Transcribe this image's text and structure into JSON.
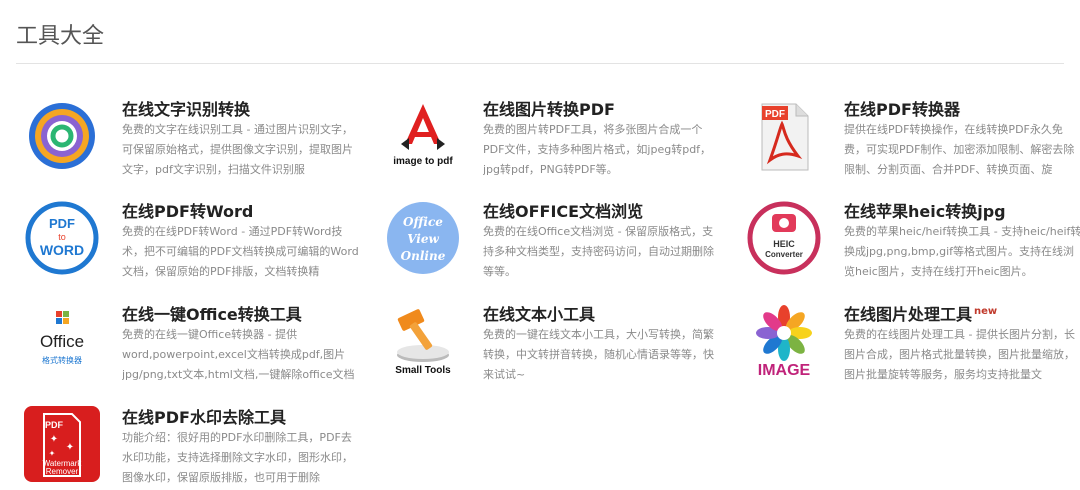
{
  "page": {
    "title": "工具大全"
  },
  "tools": [
    {
      "title": "在线文字识别转换",
      "desc": "免费的文字在线识别工具 - 通过图片识别文字，可保留原始格式，提供图像文字识别，提取图片文字，pdf文字识别，扫描文件识别服",
      "icon": "ocr-ring-icon"
    },
    {
      "title": "在线图片转换PDF",
      "desc": "免费的图片转PDF工具，将多张图片合成一个PDF文件，支持多种图片格式，如jpeg转pdf，jpg转pdf，PNG转PDF等。",
      "icon": "image-to-pdf-icon",
      "icon_text": "image to pdf"
    },
    {
      "title": "在线PDF转换器",
      "desc": "提供在线PDF转换操作，在线转换PDF永久免费，可实现PDF制作、加密添加限制、解密去除限制、分割页面、合并PDF、转换页面、旋",
      "icon": "pdf-document-icon",
      "icon_text": "PDF"
    },
    {
      "title": "在线PDF转Word",
      "desc": "免费的在线PDF转Word - 通过PDF转Word技术，把不可编辑的PDF文档转换成可编辑的Word文档，保留原始的PDF排版，文档转换精",
      "icon": "pdf-to-word-icon",
      "icon_text": [
        "PDF",
        "to",
        "WORD"
      ]
    },
    {
      "title": "在线OFFICE文档浏览",
      "desc": "免费的在线Office文档浏览 - 保留原版格式，支持多种文档类型，支持密码访问，自动过期删除等等。",
      "icon": "office-view-online-icon",
      "icon_text": [
        "Office",
        "View",
        "Online"
      ]
    },
    {
      "title": "在线苹果heic转换jpg",
      "desc": "免费的苹果heic/heif转换工具 - 支持heic/heif转换成jpg,png,bmp,gif等格式图片。支持在线浏览heic图片，支持在线打开heic图片。",
      "icon": "heic-converter-icon",
      "icon_text": [
        "HEIC",
        "Converter"
      ]
    },
    {
      "title": "在线一键Office转换工具",
      "desc": "免费的在线一键Office转换器 - 提供word,powerpoint,excel文档转换成pdf,图片jpg/png,txt文本,html文档,一键解除office文档",
      "icon": "office-converter-icon",
      "icon_text": [
        "Office",
        "格式转换器"
      ]
    },
    {
      "title": "在线文本小工具",
      "desc": "免费的一键在线文本小工具，大小写转换，简繁转换，中文转拼音转换，随机心情语录等等，快来试试~",
      "icon": "small-tools-icon",
      "icon_text": "Small Tools"
    },
    {
      "title": "在线图片处理工具",
      "badge": "new",
      "desc": "免费的在线图片处理工具 - 提供长图片分割，长图片合成，图片格式批量转换，图片批量缩放，图片批量旋转等服务，服务均支持批量文",
      "icon": "image-flower-icon",
      "icon_text": "IMAGE"
    },
    {
      "title": "在线PDF水印去除工具",
      "desc": "功能介绍：很好用的PDF水印删除工具，PDF去水印功能，支持选择删除文字水印，图形水印，图像水印，保留原版排版，也可用于删除",
      "icon": "watermark-remover-icon",
      "icon_text": [
        "PDF",
        "Watermark",
        "Remover"
      ]
    }
  ]
}
